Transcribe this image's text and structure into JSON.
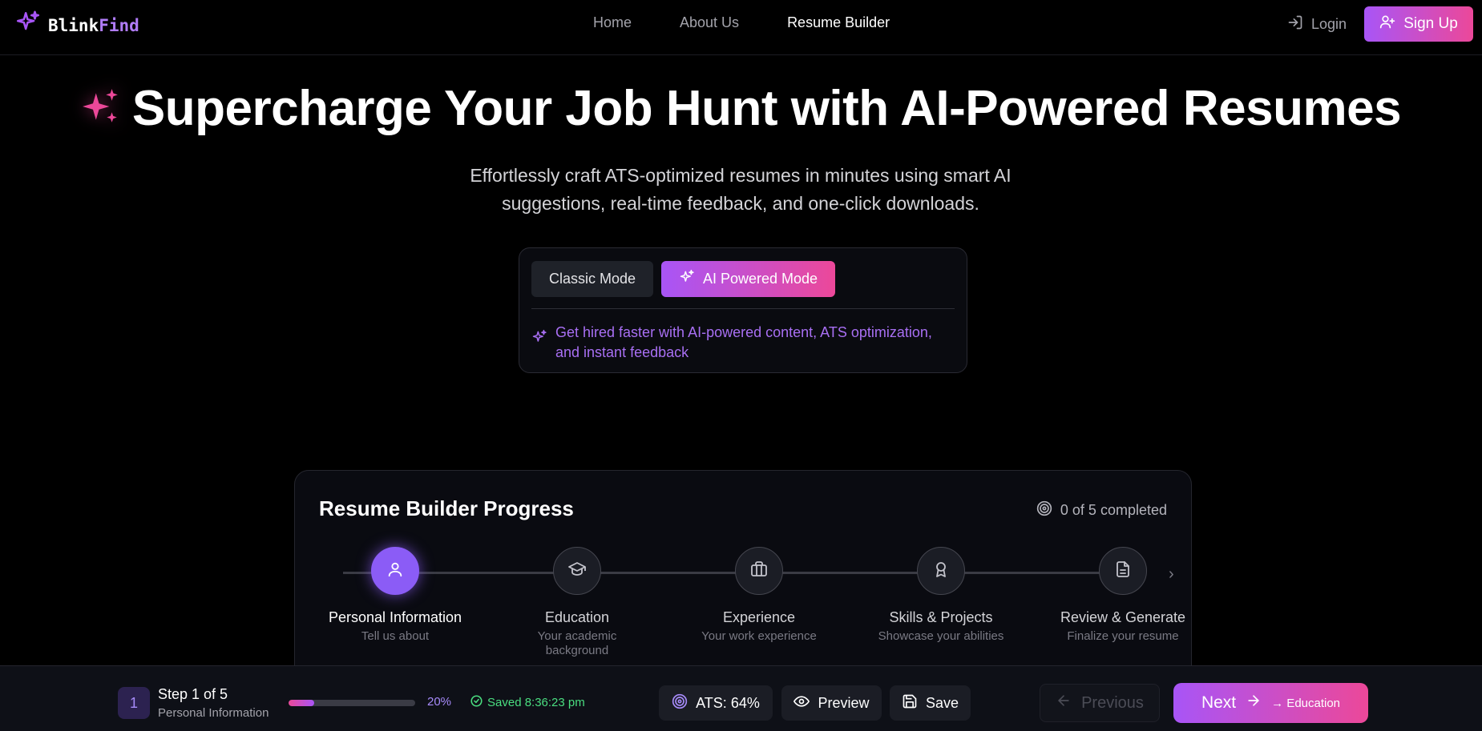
{
  "brand": {
    "name_part1": "Blink",
    "name_part2": "Find",
    "accent": "#b07cf7"
  },
  "nav": {
    "links": [
      "Home",
      "About Us",
      "Resume Builder"
    ],
    "active": "Resume Builder",
    "login_label": "Login",
    "signup_label": "Sign Up"
  },
  "hero": {
    "title": "Supercharge Your Job Hunt with AI-Powered Resumes",
    "subtitle": "Effortlessly craft ATS-optimized resumes in minutes using smart AI suggestions, real-time feedback, and one-click downloads."
  },
  "mode": {
    "classic_label": "Classic Mode",
    "ai_label": "AI Powered Mode",
    "selected": "AI Powered Mode",
    "hint": "Get hired faster with AI-powered content, ATS optimization, and instant feedback"
  },
  "progress": {
    "title": "Resume Builder Progress",
    "completed_text": "0 of 5 completed",
    "steps": [
      {
        "label": "Personal Information",
        "desc": "Tell us about",
        "icon": "user-icon",
        "active": true
      },
      {
        "label": "Education",
        "desc": "Your academic background",
        "icon": "graduation-cap-icon",
        "active": false
      },
      {
        "label": "Experience",
        "desc": "Your work experience",
        "icon": "briefcase-icon",
        "active": false
      },
      {
        "label": "Skills & Projects",
        "desc": "Showcase your abilities",
        "icon": "award-icon",
        "active": false
      },
      {
        "label": "Review & Generate",
        "desc": "Finalize your resume",
        "icon": "document-icon",
        "active": false
      }
    ]
  },
  "bottom": {
    "step_number": "1",
    "step_of": "Step 1 of 5",
    "step_name": "Personal Information",
    "progress_fraction": 0.2,
    "percent_text": "20%",
    "saved_text": "Saved 8:36:23 pm",
    "ats_text": "ATS: 64%",
    "preview_label": "Preview",
    "save_label": "Save",
    "previous_label": "Previous",
    "next_label": "Next",
    "next_sub": "→ Education"
  },
  "colors": {
    "gradient_start": "#a855f7",
    "gradient_end": "#ec4899",
    "success": "#4ade80"
  }
}
